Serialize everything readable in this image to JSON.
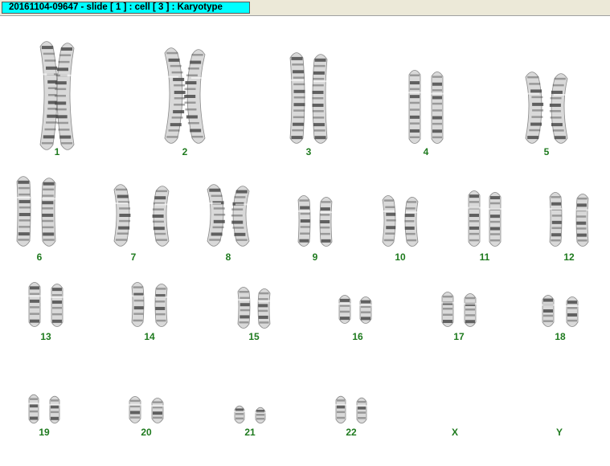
{
  "window": {
    "title": "20161104-09647 - slide [ 1 ] : cell [ 3 ] : Karyotype"
  },
  "colors": {
    "label": "#1e7a1e",
    "chromosome": "#4a4a4a",
    "title_tab": "#00ffff"
  },
  "chromosome_labels": [
    "1",
    "2",
    "3",
    "4",
    "5",
    "6",
    "7",
    "8",
    "9",
    "10",
    "11",
    "12",
    "13",
    "14",
    "15",
    "16",
    "17",
    "18",
    "19",
    "20",
    "21",
    "22",
    "X",
    "Y"
  ]
}
